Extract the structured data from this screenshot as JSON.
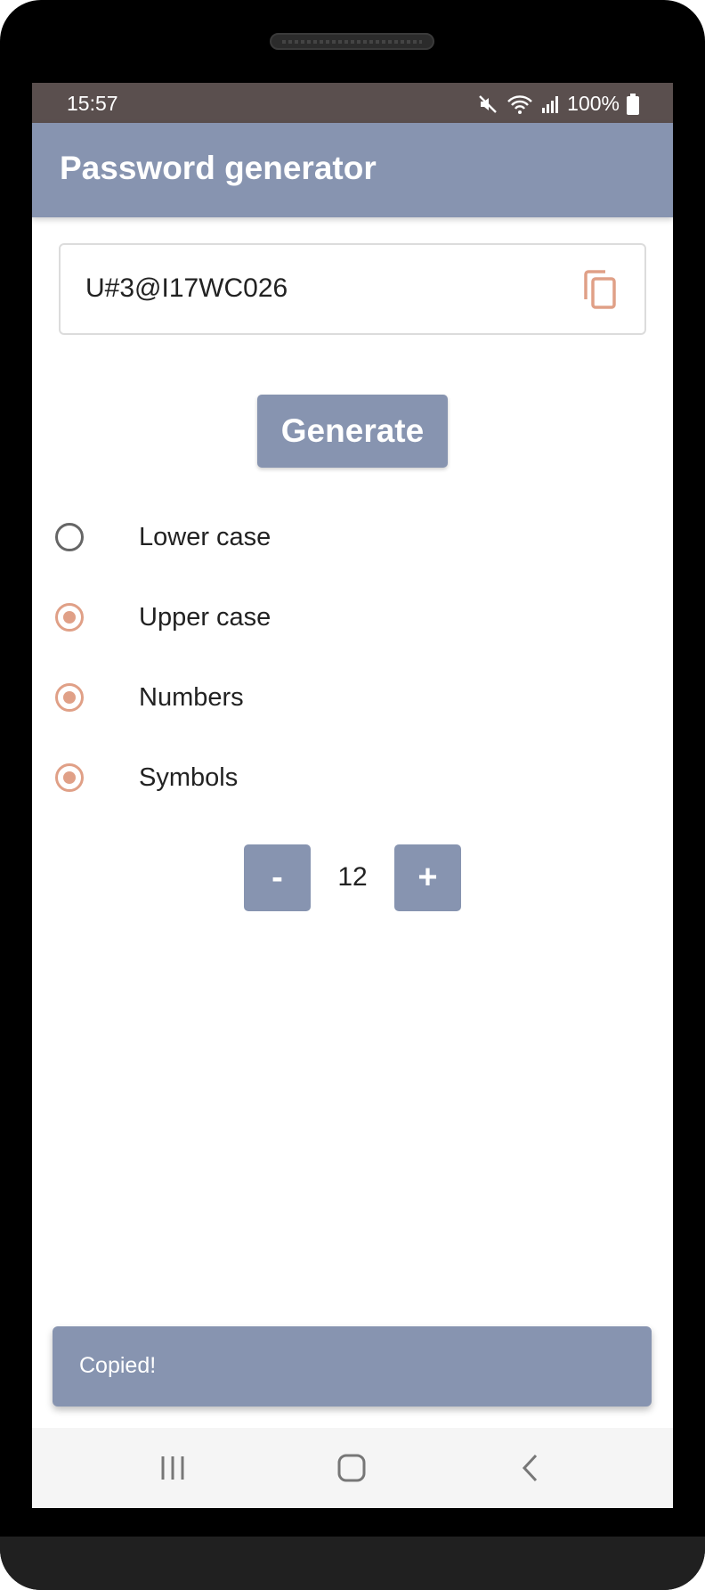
{
  "status_bar": {
    "time": "15:57",
    "battery": "100%",
    "icons": [
      "mute-icon",
      "wifi-icon",
      "signal-icon",
      "battery-icon"
    ]
  },
  "app_bar": {
    "title": "Password generator"
  },
  "password": {
    "value": "U#3@I17WC026",
    "copy_icon": "copy-icon"
  },
  "generate_button": {
    "label": "Generate"
  },
  "options": [
    {
      "label": "Lower case",
      "selected": false
    },
    {
      "label": "Upper case",
      "selected": true
    },
    {
      "label": "Numbers",
      "selected": true
    },
    {
      "label": "Symbols",
      "selected": true
    }
  ],
  "length": {
    "decrement_label": "-",
    "value": "12",
    "increment_label": "+"
  },
  "toast": {
    "message": "Copied!"
  },
  "nav_bar": {
    "icons": [
      "recents-icon",
      "home-icon",
      "back-icon"
    ]
  },
  "colors": {
    "accent": "#8794b0",
    "radio_selected": "#e0a087",
    "status_bar": "#5a4f4e"
  }
}
